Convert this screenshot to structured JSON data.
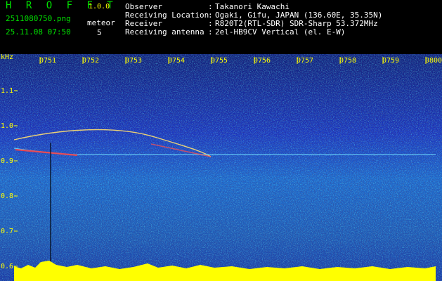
{
  "header": {
    "app_name": "H R O F F T",
    "version": "1.0.0",
    "filename": "2511080750.png",
    "timestamp": "25.11.08 07:50",
    "meteor_label": "meteor",
    "meteor_count": "5",
    "rows": [
      {
        "label": "Observer",
        "colon": ":",
        "value": "Takanori Kawachi"
      },
      {
        "label": "Receiving Location",
        "colon": ":",
        "value": "Ogaki, Gifu, JAPAN (136.60E, 35.35N)"
      },
      {
        "label": "Receiver",
        "colon": ":",
        "value": "R820T2(RTL-SDR) SDR-Sharp 53.372MHz"
      },
      {
        "label": "Receiving antenna",
        "colon": ":",
        "value": "2el-HB9CV Vertical (el. E-W)"
      }
    ]
  },
  "spectrogram": {
    "y_unit": "kHz",
    "y_ticks": [
      "1.1",
      "1.0",
      "0.9",
      "0.8",
      "0.7",
      "0.6"
    ],
    "time_ticks": [
      "0751",
      "0752",
      "0753",
      "0754",
      "0755",
      "0756",
      "0757",
      "0758",
      "0759",
      "0800"
    ],
    "colors": {
      "background": "#1a2fb8",
      "accent": "#ffff00",
      "label": "#ffff00"
    }
  }
}
